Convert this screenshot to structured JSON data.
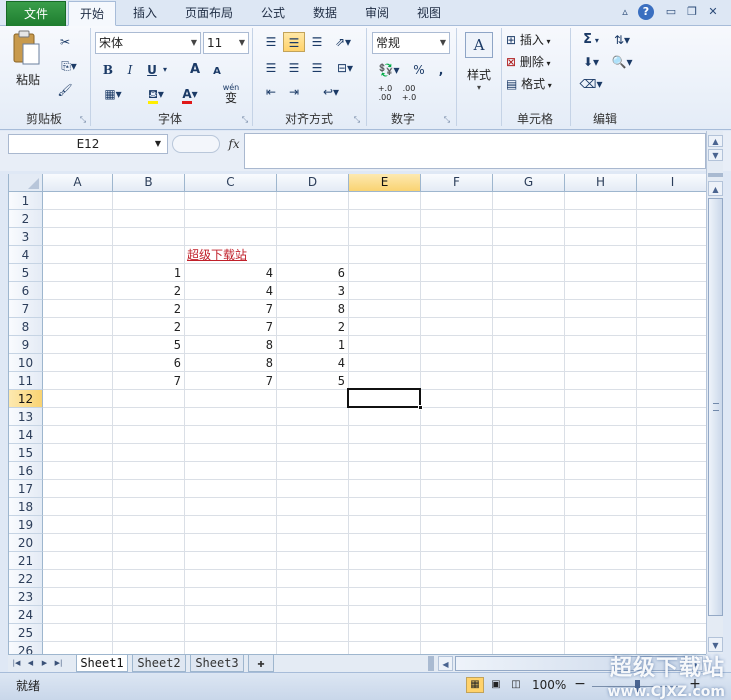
{
  "ribbon_tabs": [
    "文件",
    "开始",
    "插入",
    "页面布局",
    "公式",
    "数据",
    "审阅",
    "视图"
  ],
  "clipboard": {
    "paste_label": "粘贴",
    "group_label": "剪贴板"
  },
  "font": {
    "name": "宋体",
    "size": "11",
    "bold": "B",
    "italic": "I",
    "underline": "U",
    "grow": "A",
    "shrink": "A",
    "wen": "wén",
    "wen_char": "变",
    "group_label": "字体"
  },
  "align": {
    "group_label": "对齐方式"
  },
  "number": {
    "format": "常规",
    "percent": "%",
    "comma": ",",
    "inc": ".00",
    "inc_sub": "+.0",
    "dec": ".00",
    "dec_sub": "+.0",
    "group_label": "数字"
  },
  "styles": {
    "label": "样式"
  },
  "cells": {
    "insert": "插入",
    "delete": "删除",
    "format": "格式",
    "group_label": "单元格"
  },
  "editing": {
    "sigma": "Σ",
    "group_label": "编辑"
  },
  "formula_bar": {
    "name_box": "E12",
    "fx": "fx"
  },
  "columns": [
    "A",
    "B",
    "C",
    "D",
    "E",
    "F",
    "G",
    "H",
    "I"
  ],
  "active_column": "E",
  "rows": [
    "1",
    "2",
    "3",
    "4",
    "5",
    "6",
    "7",
    "8",
    "9",
    "10",
    "11",
    "12",
    "13",
    "14",
    "15",
    "16",
    "17",
    "18",
    "19",
    "20",
    "21",
    "22",
    "23",
    "24",
    "25",
    "26"
  ],
  "active_row": "12",
  "title_cell": "超级下载站",
  "data_rows": [
    [
      "1",
      "4",
      "6"
    ],
    [
      "2",
      "4",
      "3"
    ],
    [
      "2",
      "7",
      "8"
    ],
    [
      "2",
      "7",
      "2"
    ],
    [
      "5",
      "8",
      "1"
    ],
    [
      "6",
      "8",
      "4"
    ],
    [
      "7",
      "7",
      "5"
    ]
  ],
  "sheet_tabs": [
    "Sheet1",
    "Sheet2",
    "Sheet3"
  ],
  "active_sheet": "Sheet1",
  "status": {
    "ready": "就绪",
    "zoom": "100%",
    "minus": "−",
    "plus": "+"
  },
  "watermark": {
    "title": "超级下载站",
    "url": "www.CJXZ.com"
  },
  "colors": {
    "accent": "#c0202a",
    "file_tab": "#2a8c3c",
    "selection": "#f9d372"
  }
}
